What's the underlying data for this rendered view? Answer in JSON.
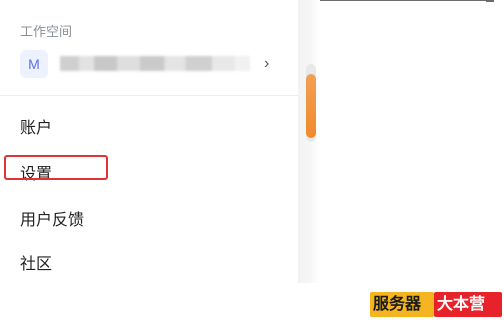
{
  "panel": {
    "section_label": "工作空间",
    "workspace": {
      "avatar_letter": "M",
      "name": "",
      "chevron": "›"
    },
    "menu": {
      "account": "账户",
      "settings": "设置",
      "feedback": "用户反馈",
      "community": "社区"
    }
  },
  "colors": {
    "highlight": "#e23434",
    "scroll_thumb": "#f08a2a",
    "avatar_bg": "#eef2ff",
    "avatar_fg": "#5a72e8"
  },
  "watermark": {
    "part1": "服务器",
    "part2": "大本营"
  }
}
